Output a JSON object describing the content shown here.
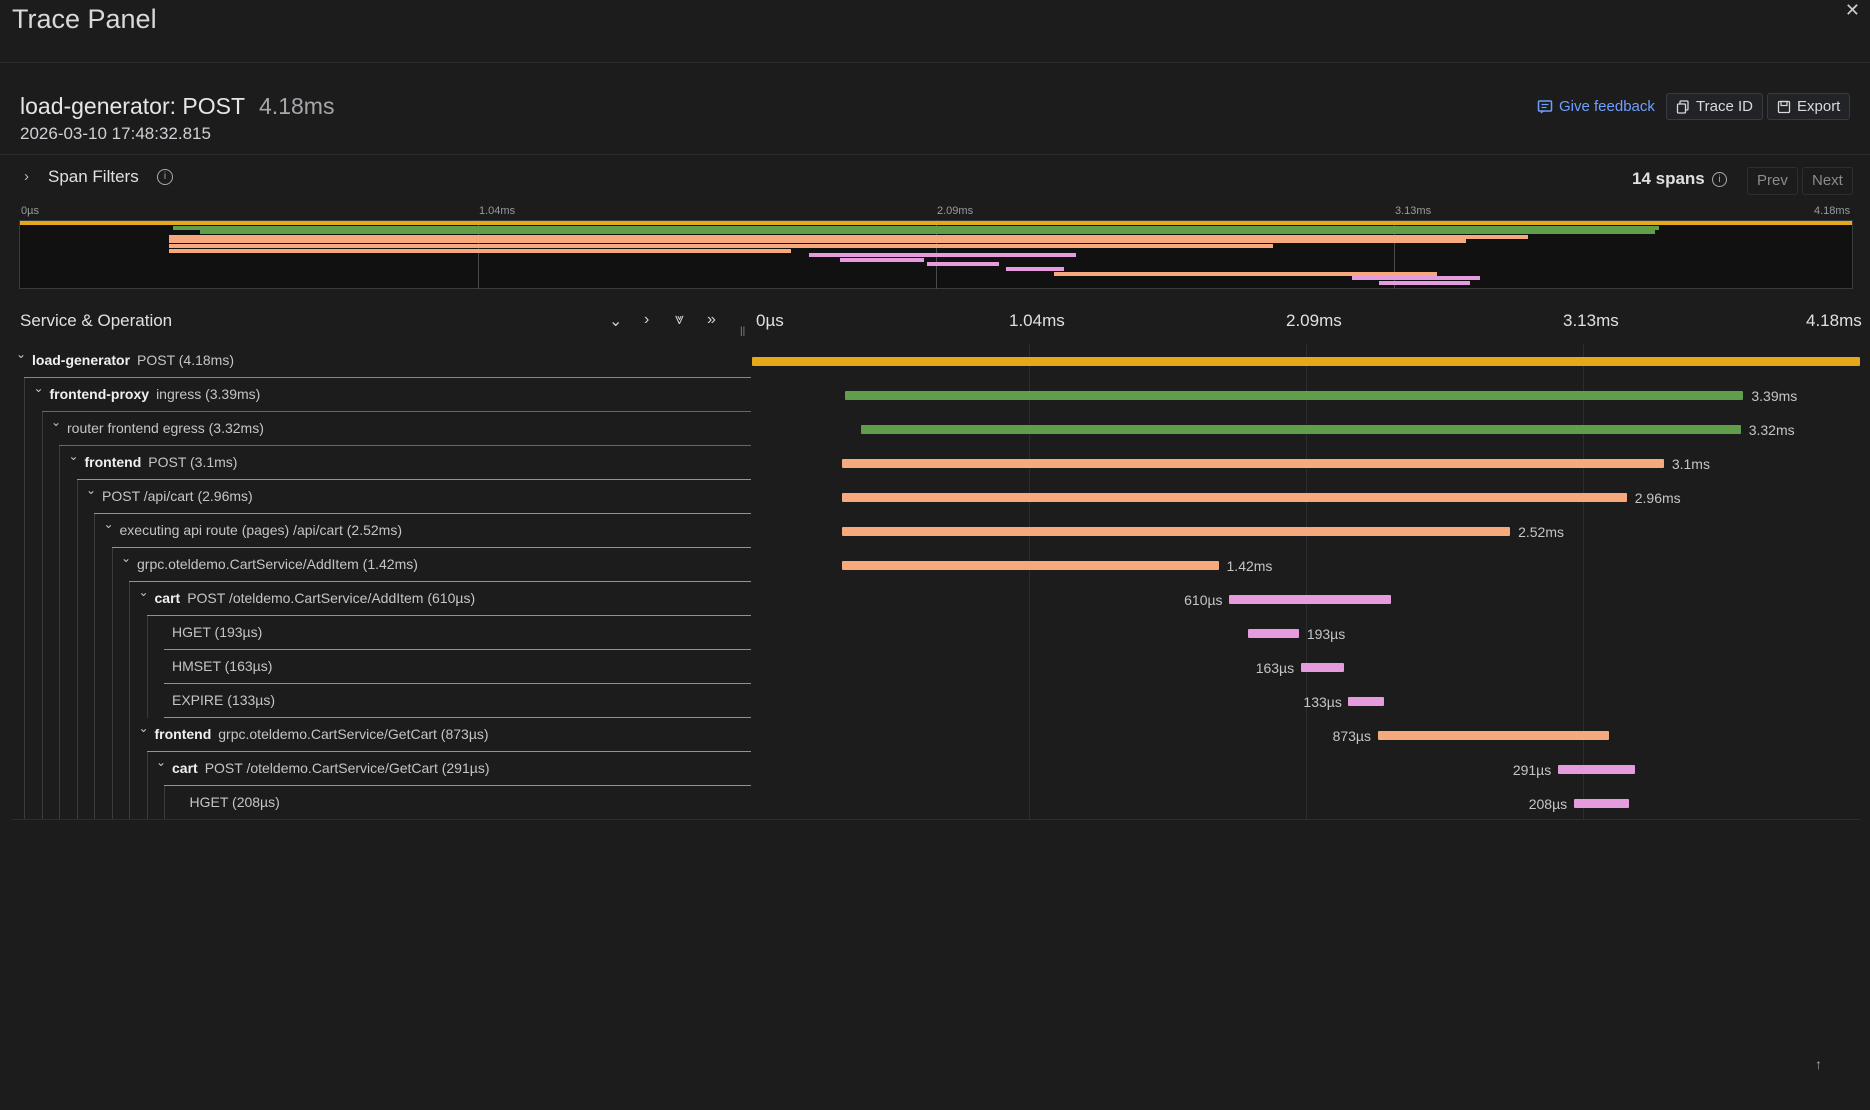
{
  "panel": {
    "title": "Trace Panel",
    "close_icon": "close-icon"
  },
  "trace": {
    "service": "load-generator: POST",
    "duration": "4.18ms",
    "timestamp": "2026-03-10 17:48:32.815"
  },
  "header_actions": {
    "feedback": "Give feedback",
    "trace_id": "Trace ID",
    "export": "Export"
  },
  "filters": {
    "label": "Span Filters",
    "span_count": "14 spans",
    "prev": "Prev",
    "next": "Next"
  },
  "axis": {
    "ticks": [
      "0µs",
      "1.04ms",
      "2.09ms",
      "3.13ms",
      "4.18ms"
    ],
    "total_ms": 4.18
  },
  "table": {
    "column_label": "Service & Operation",
    "controls": [
      "collapse-one-icon",
      "expand-one-icon",
      "collapse-all-icon",
      "expand-all-icon"
    ]
  },
  "colors": {
    "load-generator": "#e5a81b",
    "frontend-proxy": "#5f9e4a",
    "frontend": "#f5a97c",
    "cart": "#e59bde"
  },
  "spans": [
    {
      "service": "load-generator",
      "op": "POST (4.18ms)",
      "depth": 0,
      "start_ms": 0.0,
      "dur_ms": 4.18,
      "label": "",
      "bold": true,
      "chevron": true
    },
    {
      "service": "frontend-proxy",
      "op": "ingress (3.39ms)",
      "depth": 1,
      "start_ms": 0.35,
      "dur_ms": 3.39,
      "label": "3.39ms",
      "bold": true,
      "chevron": true
    },
    {
      "service": "frontend-proxy",
      "op": "router frontend egress (3.32ms)",
      "depth": 2,
      "start_ms": 0.41,
      "dur_ms": 3.32,
      "label": "3.32ms",
      "bold": false,
      "chevron": true
    },
    {
      "service": "frontend",
      "op": "POST (3.1ms)",
      "depth": 3,
      "start_ms": 0.34,
      "dur_ms": 3.1,
      "label": "3.1ms",
      "bold": true,
      "chevron": true
    },
    {
      "service": "frontend",
      "op": "POST /api/cart (2.96ms)",
      "depth": 4,
      "start_ms": 0.34,
      "dur_ms": 2.96,
      "label": "2.96ms",
      "bold": false,
      "chevron": true
    },
    {
      "service": "frontend",
      "op": "executing api route (pages) /api/cart (2.52ms)",
      "depth": 5,
      "start_ms": 0.34,
      "dur_ms": 2.52,
      "label": "2.52ms",
      "bold": false,
      "chevron": true
    },
    {
      "service": "frontend",
      "op": "grpc.oteldemo.CartService/AddItem (1.42ms)",
      "depth": 6,
      "start_ms": 0.34,
      "dur_ms": 1.42,
      "label": "1.42ms",
      "bold": false,
      "chevron": true
    },
    {
      "service": "cart",
      "op": "POST /oteldemo.CartService/AddItem (610µs)",
      "depth": 7,
      "start_ms": 1.8,
      "dur_ms": 0.61,
      "label": "610µs",
      "bold": true,
      "chevron": true,
      "label_left": true
    },
    {
      "service": "cart",
      "op": "HGET (193µs)",
      "depth": 8,
      "start_ms": 1.87,
      "dur_ms": 0.193,
      "label": "193µs",
      "bold": false,
      "chevron": false
    },
    {
      "service": "cart",
      "op": "HMSET (163µs)",
      "depth": 8,
      "start_ms": 2.07,
      "dur_ms": 0.163,
      "label": "163µs",
      "bold": false,
      "chevron": false,
      "label_left": true
    },
    {
      "service": "cart",
      "op": "EXPIRE (133µs)",
      "depth": 8,
      "start_ms": 2.25,
      "dur_ms": 0.133,
      "label": "133µs",
      "bold": false,
      "chevron": false,
      "label_left": true
    },
    {
      "service": "frontend",
      "op": "grpc.oteldemo.CartService/GetCart (873µs)",
      "depth": 7,
      "start_ms": 2.36,
      "dur_ms": 0.873,
      "label": "873µs",
      "bold": true,
      "chevron": true,
      "label_left": true,
      "display_service": "frontend"
    },
    {
      "service": "cart",
      "op": "POST /oteldemo.CartService/GetCart (291µs)",
      "depth": 8,
      "start_ms": 3.04,
      "dur_ms": 0.291,
      "label": "291µs",
      "bold": true,
      "chevron": true,
      "label_left": true
    },
    {
      "service": "cart",
      "op": "HGET (208µs)",
      "depth": 9,
      "start_ms": 3.1,
      "dur_ms": 0.208,
      "label": "208µs",
      "bold": false,
      "chevron": false,
      "label_left": true
    }
  ]
}
